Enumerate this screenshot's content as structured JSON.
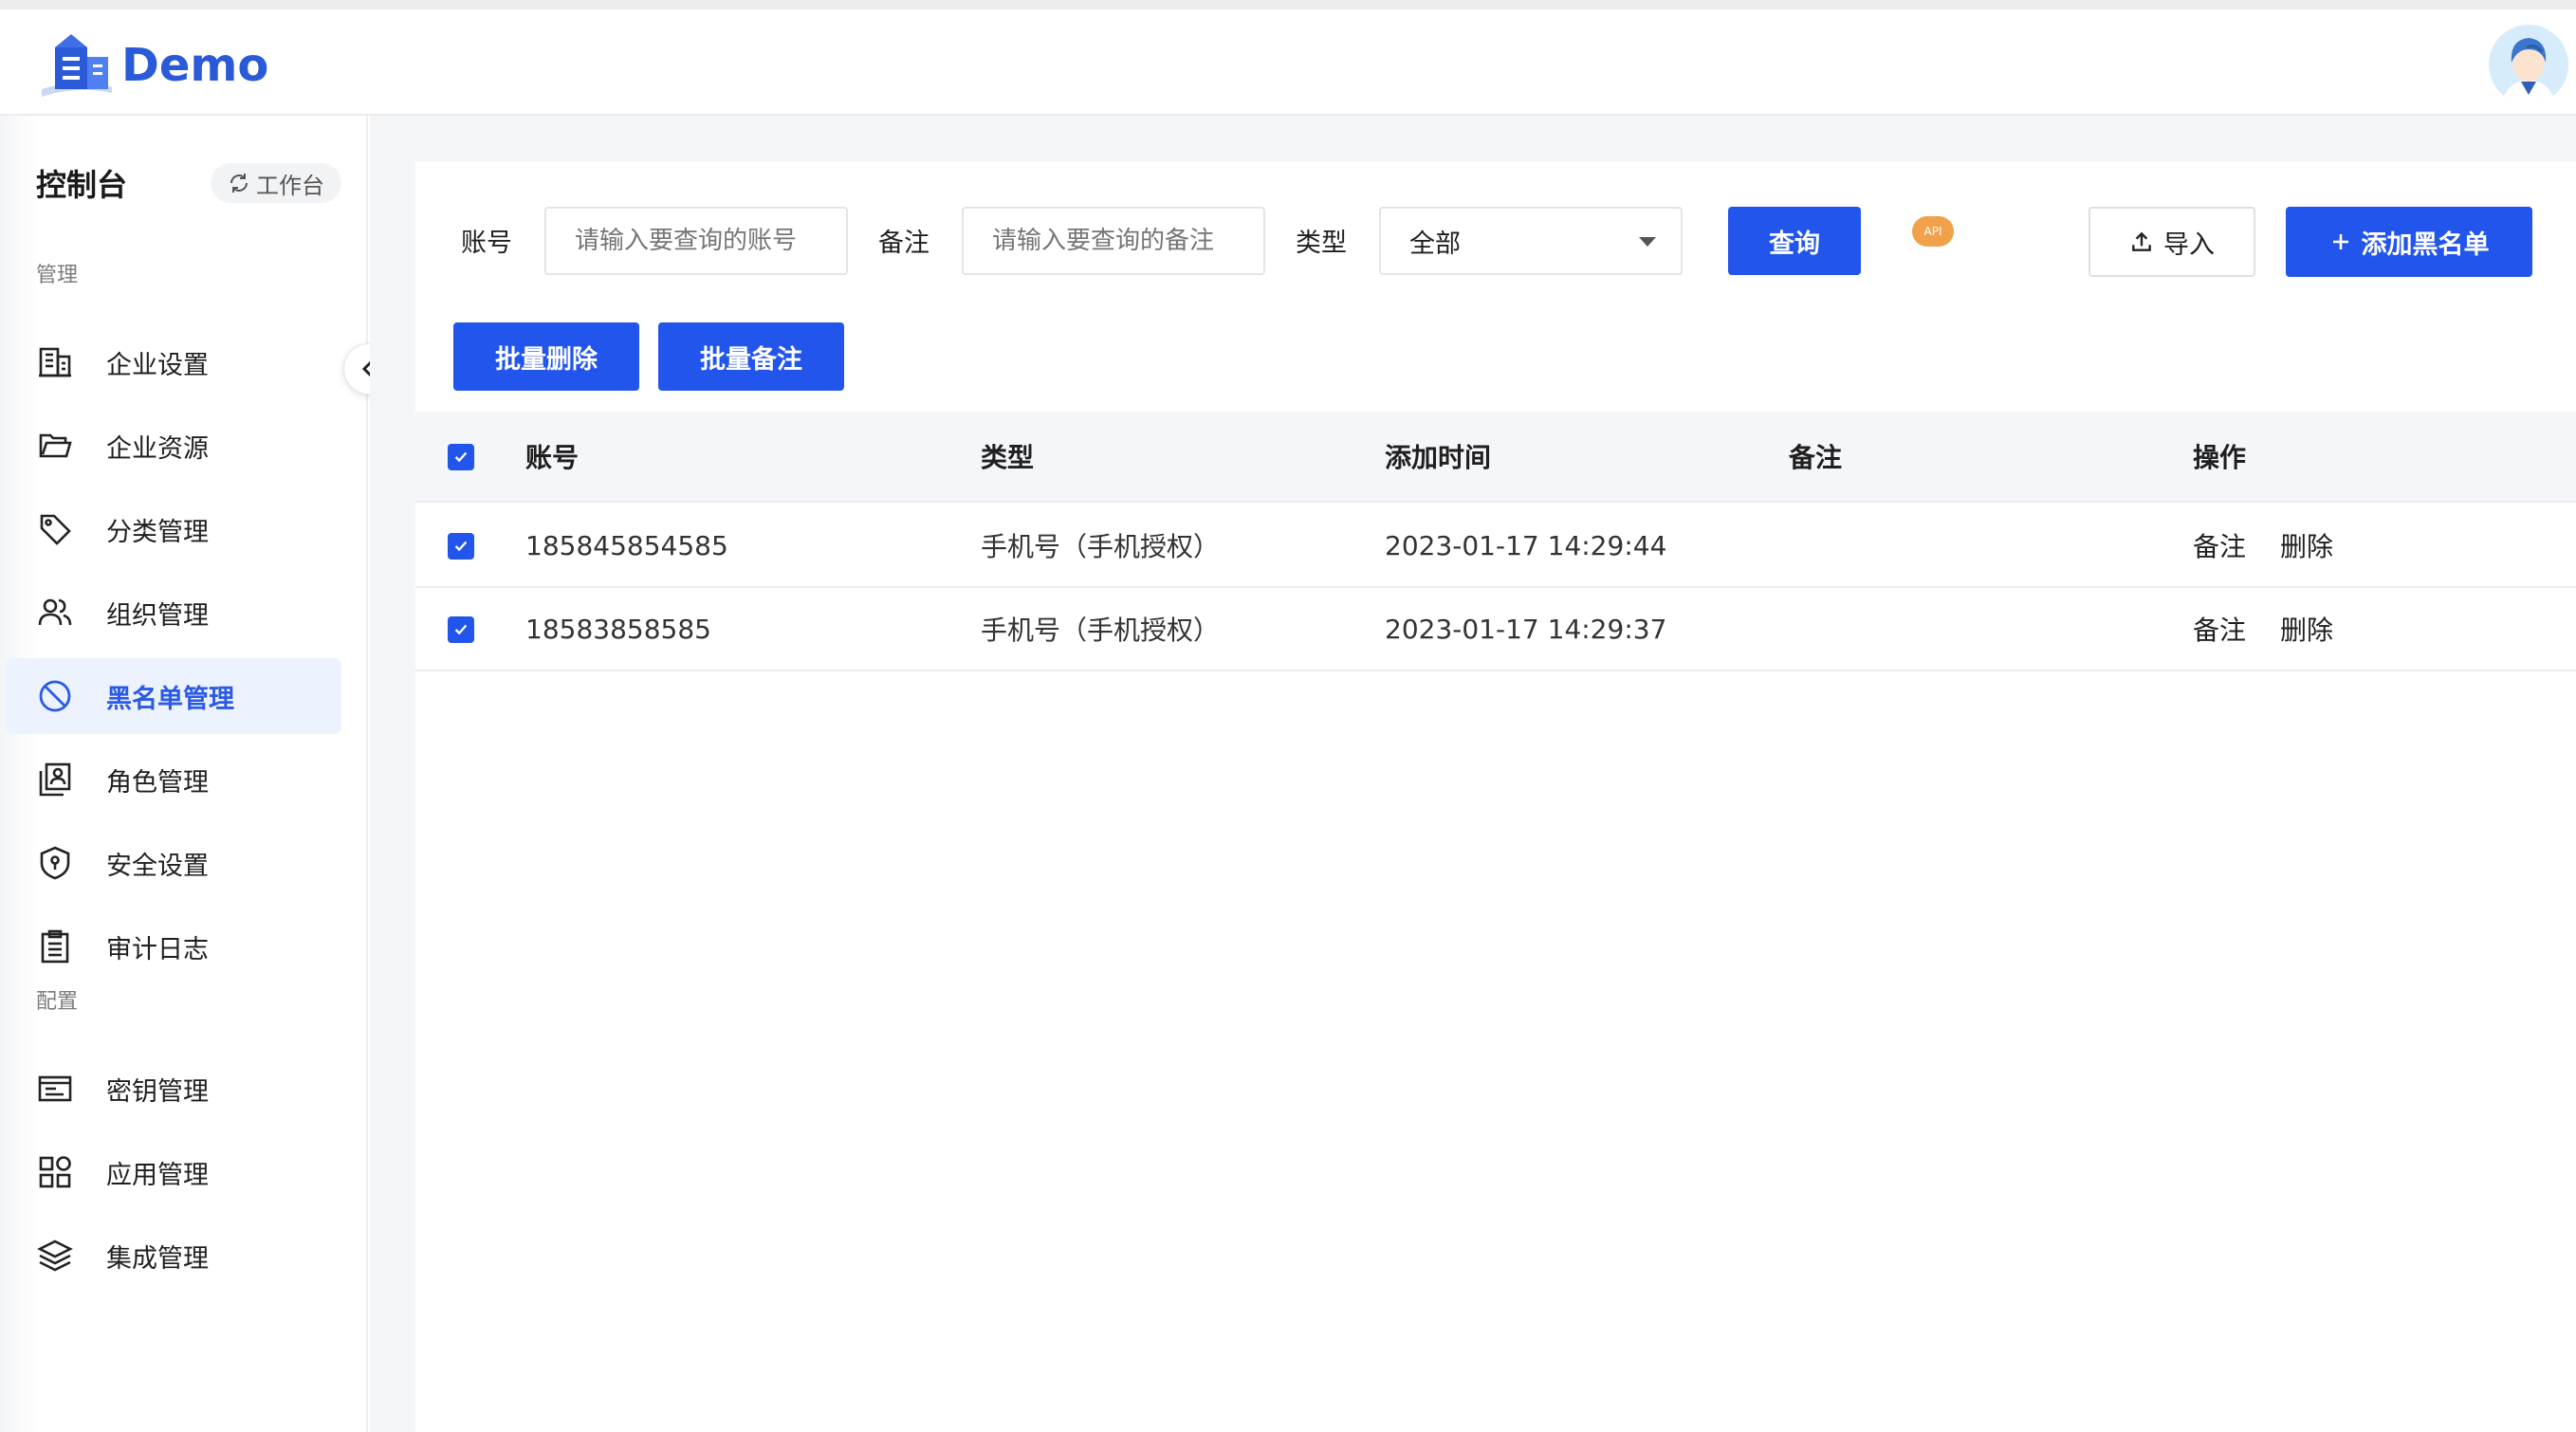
{
  "app": {
    "logo_text": "Demo"
  },
  "sidebar": {
    "title": "控制台",
    "workbench_label": "工作台",
    "groups": [
      {
        "label": "管理"
      },
      {
        "label": "配置"
      }
    ],
    "items": [
      {
        "label": "企业设置",
        "icon": "building-icon"
      },
      {
        "label": "企业资源",
        "icon": "folder-icon"
      },
      {
        "label": "分类管理",
        "icon": "tag-icon"
      },
      {
        "label": "组织管理",
        "icon": "users-icon"
      },
      {
        "label": "黑名单管理",
        "icon": "ban-icon",
        "active": true
      },
      {
        "label": "角色管理",
        "icon": "role-icon"
      },
      {
        "label": "安全设置",
        "icon": "shield-icon"
      },
      {
        "label": "审计日志",
        "icon": "clipboard-icon"
      },
      {
        "label": "密钥管理",
        "icon": "key-card-icon"
      },
      {
        "label": "应用管理",
        "icon": "apps-icon"
      },
      {
        "label": "集成管理",
        "icon": "layers-icon"
      }
    ]
  },
  "filters": {
    "account_label": "账号",
    "account_placeholder": "请输入要查询的账号",
    "remark_label": "备注",
    "remark_placeholder": "请输入要查询的备注",
    "type_label": "类型",
    "type_value": "全部",
    "query_button": "查询",
    "api_badge": "API",
    "import_button": "导入",
    "add_button": "添加黑名单",
    "batch_delete_button": "批量删除",
    "batch_remark_button": "批量备注"
  },
  "table": {
    "columns": [
      "账号",
      "类型",
      "添加时间",
      "备注",
      "操作"
    ],
    "rows": [
      {
        "account": "185845854585",
        "type": "手机号（手机授权）",
        "time": "2023-01-17 14:29:44",
        "remark": "",
        "checked": true
      },
      {
        "account": "18583858585",
        "type": "手机号（手机授权）",
        "time": "2023-01-17 14:29:37",
        "remark": "",
        "checked": true
      }
    ],
    "row_actions": [
      "备注",
      "删除"
    ]
  },
  "colors": {
    "primary": "#2155eb",
    "active_bg": "#edf2ff",
    "api_badge": "#f0a14a"
  }
}
